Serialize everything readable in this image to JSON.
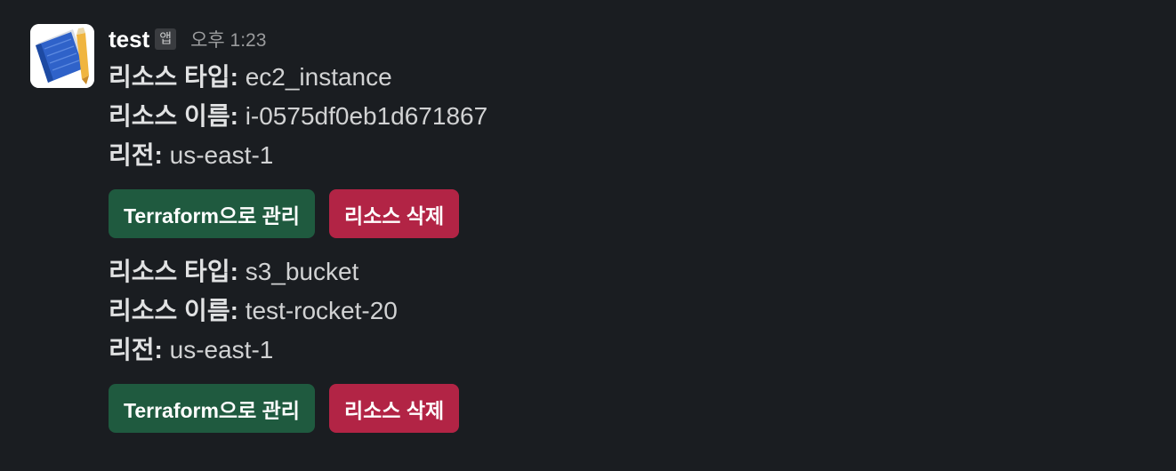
{
  "message": {
    "sender": "test",
    "app_badge": "앱",
    "time": "오후 1:23"
  },
  "resources": [
    {
      "type_label": "리소스 타입:",
      "type_value": "ec2_instance",
      "name_label": "리소스 이름:",
      "name_value": "i-0575df0eb1d671867",
      "region_label": "리전:",
      "region_value": "us-east-1",
      "manage_button": "Terraform으로 관리",
      "delete_button": "리소스 삭제"
    },
    {
      "type_label": "리소스 타입:",
      "type_value": "s3_bucket",
      "name_label": "리소스 이름:",
      "name_value": "test-rocket-20",
      "region_label": "리전:",
      "region_value": "us-east-1",
      "manage_button": "Terraform으로 관리",
      "delete_button": "리소스 삭제"
    }
  ],
  "colors": {
    "background": "#1a1d21",
    "manage_button": "#1f5a3f",
    "delete_button": "#b22445"
  },
  "icons": {
    "avatar": "notebook-pencil-icon"
  }
}
